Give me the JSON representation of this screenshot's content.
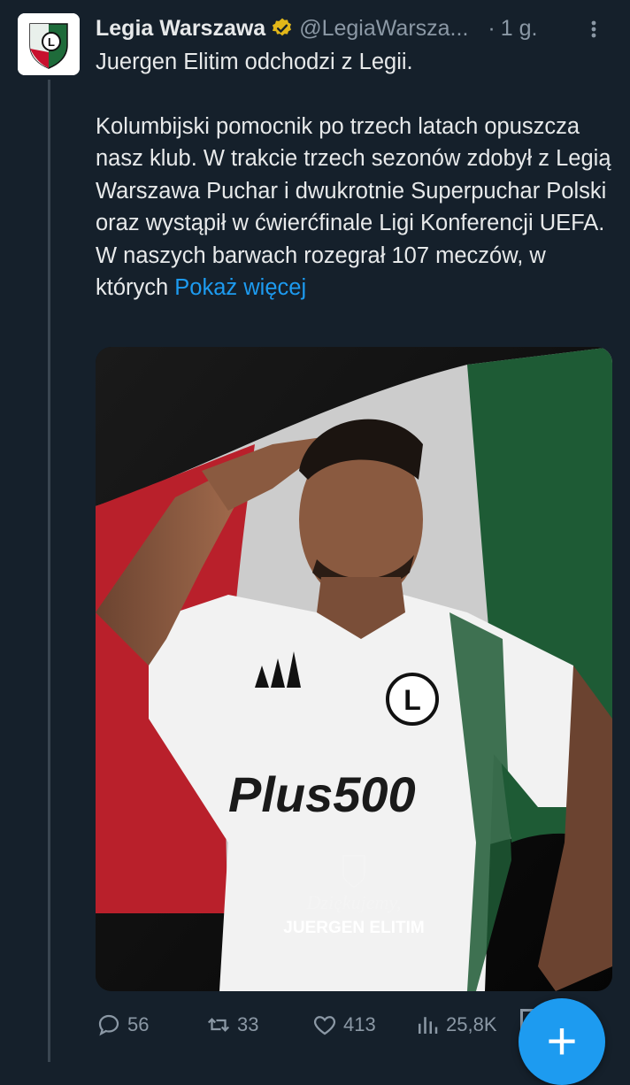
{
  "tweet": {
    "author_name": "Legia Warszawa",
    "handle": "@LegiaWarsza...",
    "separator": "·",
    "time": "1 g.",
    "headline": "Juergen Elitim odchodzi z Legii.",
    "body": "Kolumbijski pomocnik po trzech latach opuszcza nasz klub. W trakcie trzech sezonów zdobył z Legią Warszawa Puchar i dwukrotnie Superpuchar Polski oraz wystąpił w ćwierćfinale Ligi Konferencji UEFA. W naszych barwach rozegrał 107 meczów, w których",
    "show_more": "Pokaż więcej"
  },
  "media": {
    "sponsor_text": "Plus500",
    "crest_letter": "L",
    "thanks_text": "Dziękujemy,",
    "player_name": "JUERGEN ELITIM"
  },
  "actions": {
    "replies": "56",
    "reposts": "33",
    "likes": "413",
    "views": "25,8K"
  },
  "icons": {
    "more": "more-vertical-icon",
    "verified": "verified-gold-badge-icon",
    "reply": "reply-icon",
    "repost": "repost-icon",
    "like": "heart-icon",
    "views": "views-chart-icon",
    "compose": "plus-icon"
  },
  "colors": {
    "background": "#15202b",
    "accent": "#1d9bf0",
    "muted": "#8b98a5",
    "verified_gold": "#e2b719",
    "flag_white": "#dcdcdc",
    "flag_green": "#1e5b35",
    "flag_red": "#b9202b"
  }
}
